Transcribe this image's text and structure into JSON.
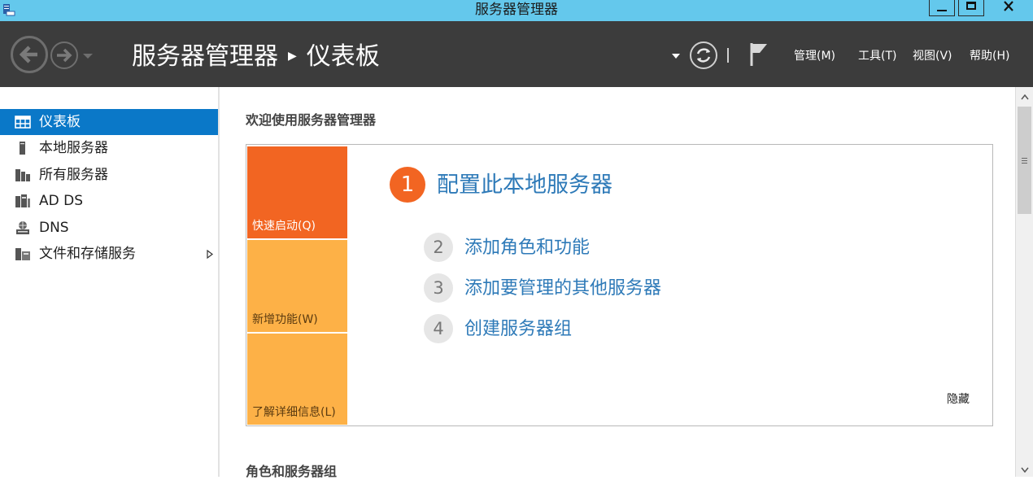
{
  "window": {
    "title": "服务器管理器",
    "minimize_glyph": "—",
    "maximize_glyph": "□",
    "close_glyph": "✕"
  },
  "header": {
    "breadcrumb_root": "服务器管理器",
    "breadcrumb_sep": "▶",
    "breadcrumb_current": "仪表板",
    "menus": [
      "管理(M)",
      "工具(T)",
      "视图(V)",
      "帮助(H)"
    ],
    "icons": [
      "back-arrow-icon",
      "forward-arrow-icon",
      "dropdown-icon",
      "refresh-icon",
      "flag-icon"
    ]
  },
  "sidebar": {
    "items": [
      {
        "label": "仪表板",
        "icon": "dashboard-icon",
        "active": true
      },
      {
        "label": "本地服务器",
        "icon": "server-icon"
      },
      {
        "label": "所有服务器",
        "icon": "servers-icon"
      },
      {
        "label": "AD DS",
        "icon": "ad-ds-icon"
      },
      {
        "label": "DNS",
        "icon": "dns-icon"
      },
      {
        "label": "文件和存储服务",
        "icon": "storage-icon",
        "has_submenu": true
      }
    ]
  },
  "main": {
    "welcome_title": "欢迎使用服务器管理器",
    "tiles": [
      "快速启动(Q)",
      "新增功能(W)",
      "了解详细信息(L)"
    ],
    "steps": [
      {
        "num": "1",
        "text": "配置此本地服务器"
      },
      {
        "num": "2",
        "text": "添加角色和功能"
      },
      {
        "num": "3",
        "text": "添加要管理的其他服务器"
      },
      {
        "num": "4",
        "text": "创建服务器组"
      }
    ],
    "hide_label": "隐藏",
    "section2_title": "角色和服务器组"
  },
  "colors": {
    "titlebar": "#64c8ec",
    "header": "#3c3c3c",
    "active_item": "#0a78c8",
    "tile_primary": "#f26522",
    "tile_secondary": "#fdb147",
    "link": "#2e7ab8"
  }
}
